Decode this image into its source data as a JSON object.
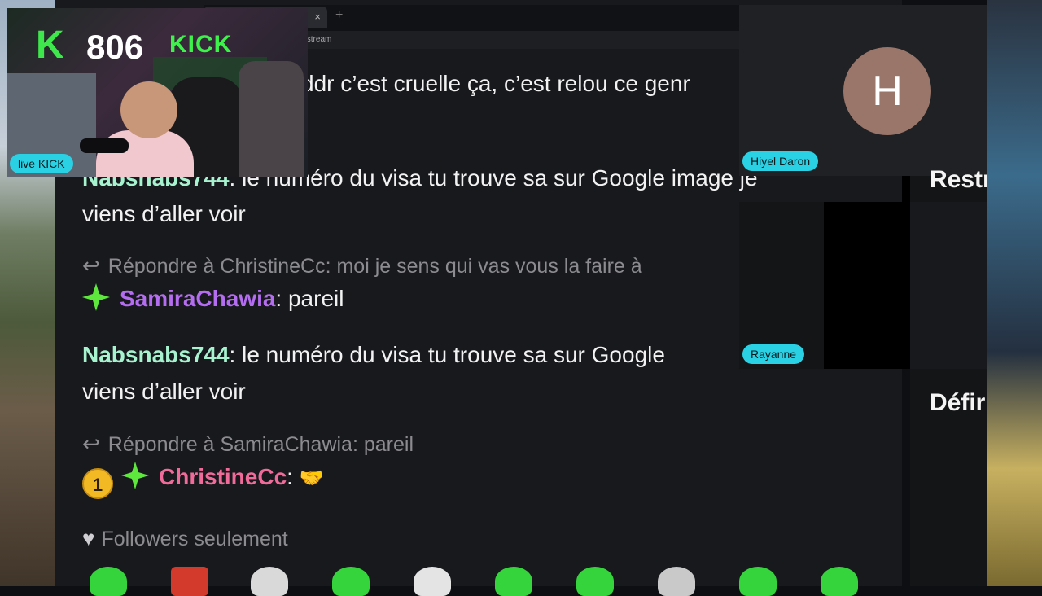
{
  "webcam": {
    "viewer_prefix": "K",
    "viewer_count": "806",
    "sign_text": "KICK",
    "label": "live KICK"
  },
  "browser": {
    "tab_close": "×",
    "tab_new": "+",
    "url": "/stream"
  },
  "chat": {
    "partial_top": "ddr c’est cruelle ça, c’est relou ce genr",
    "messages": [
      {
        "user": "Nabsnabs744",
        "text_line1": ": le numéro du visa tu trouve sa sur Google image je",
        "text_line2": "viens d’aller voir"
      },
      {
        "reply_to": "Répondre à ChristineCc: moi je sens qui vas vous la faire à",
        "user": "SamiraChawia",
        "text": ": pareil"
      },
      {
        "user": "Nabsnabs744",
        "text_line1": ": le numéro du visa tu trouve sa sur Google",
        "text_line2": "viens d’aller voir"
      },
      {
        "reply_to": "Répondre à SamiraChawia: pareil",
        "badge": "1",
        "user": "ChristineCc",
        "text": ":"
      }
    ],
    "followers_only": "Followers seulement"
  },
  "participants": {
    "main": {
      "initial": "H",
      "name": "Hiyel Daron"
    },
    "other": {
      "name": "Rayanne"
    }
  },
  "right_column": {
    "heading1": "Restr",
    "heading2": "Défir"
  },
  "icons": {
    "reply": "reply-arrow-icon",
    "sparkle": "sparkle-icon",
    "heart": "heart-icon",
    "handshake": "handshake-icon"
  },
  "colors": {
    "kick_green": "#3ee84c",
    "teal_user": "#a7f3d0",
    "purple_user": "#b46df0",
    "pink_user": "#f06b9a",
    "pill": "#2ad1e4"
  }
}
